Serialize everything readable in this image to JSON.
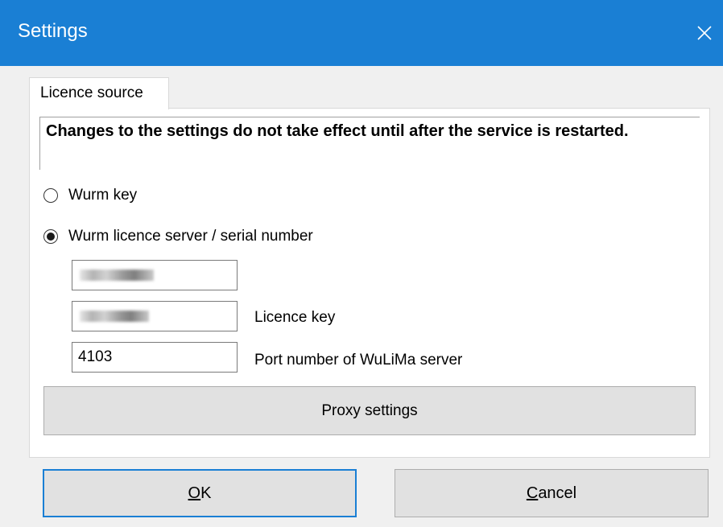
{
  "window": {
    "title": "Settings",
    "close_icon": "close-icon",
    "accent_color": "#1a7fd4"
  },
  "tabs": [
    {
      "label": "Licence source",
      "selected": true
    }
  ],
  "panel": {
    "warning": "Changes to the settings do not take effect until after the service is restarted.",
    "radios": [
      {
        "label": "Wurm key",
        "checked": false
      },
      {
        "label": "Wurm licence server / serial number",
        "checked": true
      }
    ],
    "fields": [
      {
        "value": "",
        "redacted": true,
        "label": ""
      },
      {
        "value": "",
        "redacted": true,
        "label": "Licence key"
      },
      {
        "value": "4103",
        "redacted": false,
        "label": "Port number of WuLiMa server"
      }
    ],
    "proxy_button": "Proxy settings"
  },
  "buttons": {
    "ok": {
      "accel": "O",
      "rest": "K"
    },
    "cancel": {
      "accel": "C",
      "rest": "ancel"
    }
  }
}
